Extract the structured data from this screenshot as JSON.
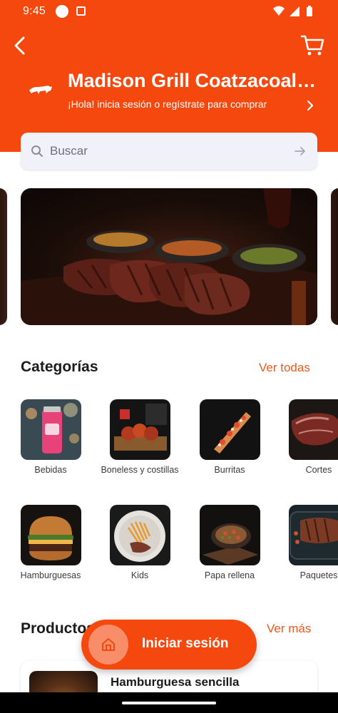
{
  "status_bar": {
    "time": "9:45"
  },
  "header": {
    "store_name": "Madison Grill Coatzacoalcos",
    "login_prompt": "¡Hola! inicia sesión o regístrate para comprar"
  },
  "search": {
    "placeholder": "Buscar"
  },
  "categories": {
    "title": "Categorías",
    "link": "Ver todas",
    "items": [
      {
        "label": "Bebidas"
      },
      {
        "label": "Boneless y costillas"
      },
      {
        "label": "Burritas"
      },
      {
        "label": "Cortes"
      },
      {
        "label": "Hamburguesas"
      },
      {
        "label": "Kids"
      },
      {
        "label": "Papa rellena"
      },
      {
        "label": "Paquetes"
      }
    ]
  },
  "products": {
    "title": "Productos",
    "link": "Ver más",
    "items": [
      {
        "name": "Hamburguesa sencilla"
      }
    ]
  },
  "login_button": {
    "label": "Iniciar sesión"
  },
  "colors": {
    "brand": "#f5480f",
    "link": "#ec5a1c"
  }
}
